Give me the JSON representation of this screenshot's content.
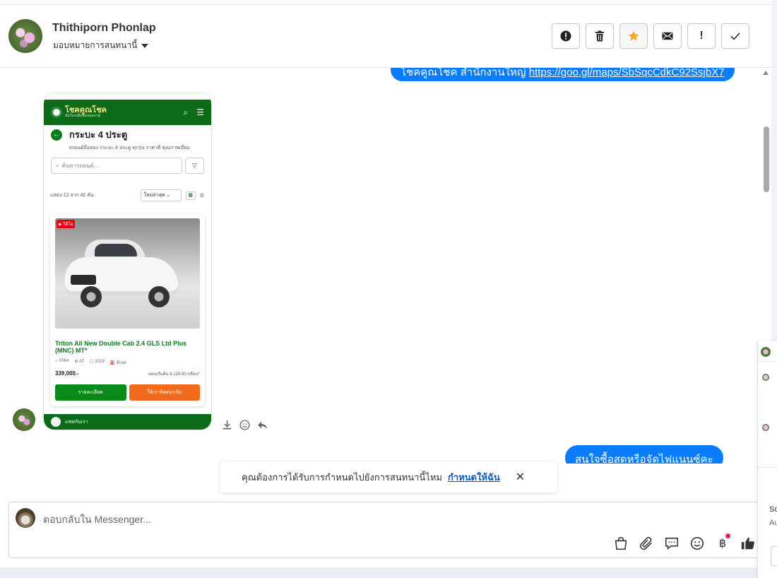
{
  "header": {
    "contact_name": "Thithiporn Phonlap",
    "assign_label": "มอบหมายการสนทนานี้"
  },
  "actions": [
    {
      "name": "spam-button",
      "icon": "alert-octagon-icon"
    },
    {
      "name": "delete-button",
      "icon": "trash-icon"
    },
    {
      "name": "star-button",
      "icon": "star-icon",
      "color": "#f5a623"
    },
    {
      "name": "mark-unread-button",
      "icon": "envelope-icon"
    },
    {
      "name": "follow-up-button",
      "icon": "exclamation-icon",
      "glyph": "!"
    },
    {
      "name": "done-button",
      "icon": "check-icon"
    }
  ],
  "thread": {
    "outgoing_top": {
      "text": "โชคคูณโชค สำนักงานใหญ่ ",
      "link": "https://goo.gl/maps/SbSqcCdkC92SsjbX7"
    },
    "phone_screenshot": {
      "brand": "โชคคูณโชค",
      "brand_sub": "มั่นใจรถมือสองคุณภาพ",
      "page_title": "กระบะ 4 ประตู",
      "page_sub": "รถยนต์มือสอง กระบะ 4 ประตู ทุกรุ่น ราคาดี คุณภาพเยี่ยม",
      "search_placeholder": "ค้นหารถยนต์...",
      "count_text": "แสดง 12 จาก 42 คัน",
      "sort_value": "ใหม่ล่าสุด",
      "video_badge": "▶ วีดีโอ",
      "car_name": "Triton All New Double Cab 2.4 GLS Ltd Plus (MNC) MT*",
      "spec_code": "Y064",
      "spec_trans": "AT",
      "spec_year": "2019",
      "spec_fuel": "ดีเซล",
      "price": "339,000.-",
      "installment": "ผ่อนเริ่มต้น 6,129.00 /เดือน*",
      "btn_details": "รายละเอียด",
      "btn_contact": "ให้เราติดต่อกลับ",
      "footer_text": "แชทกับเรา"
    },
    "outgoing_bottom": {
      "text": "สนใจซื้อสดหรือจัดไฟแนนซ์คะ"
    }
  },
  "toast": {
    "text": "คุณต้องการได้รับการกำหนดไปยังการสนทนานี้ไหม",
    "link": "กำหนดให้ฉัน"
  },
  "composer": {
    "placeholder": "ตอบกลับใน Messenger...",
    "tools": [
      "shopping-bag-icon",
      "paperclip-icon",
      "saved-reply-icon",
      "emoji-icon",
      "baht-icon",
      "thumbs-up-icon"
    ],
    "baht_glyph": "฿"
  },
  "side_panel": {
    "text_1": "So",
    "text_2": "Au"
  }
}
